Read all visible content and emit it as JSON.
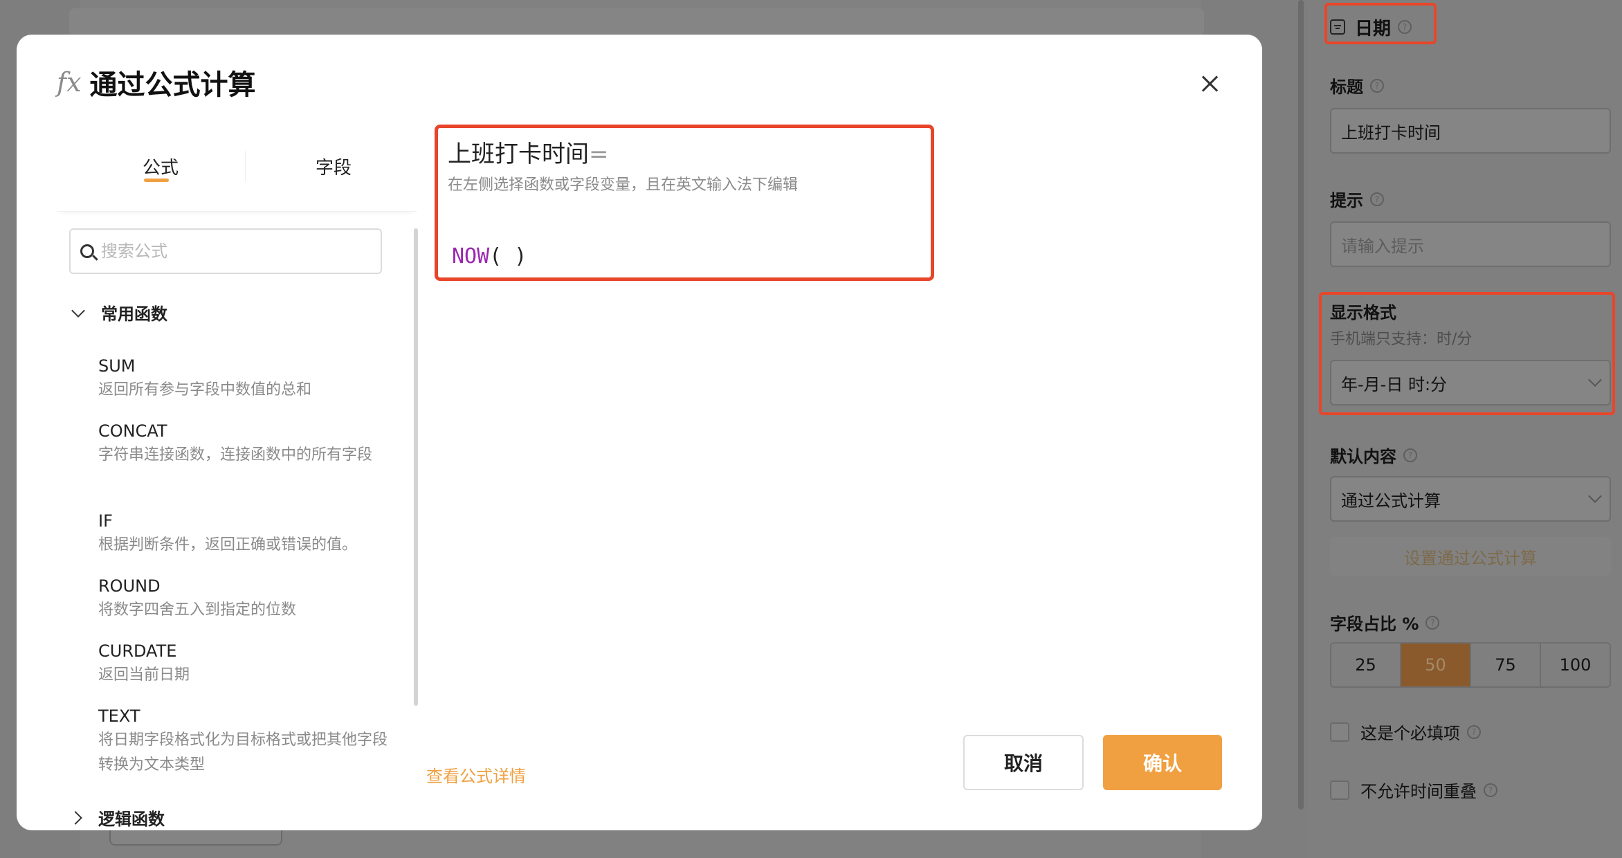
{
  "modal": {
    "title": "通过公式计算",
    "fx_glyph": "fx",
    "tabs": [
      {
        "label": "公式"
      },
      {
        "label": "字段"
      }
    ],
    "search_placeholder": "搜索公式",
    "groups": [
      {
        "label": "常用函数",
        "functions": [
          {
            "name": "SUM",
            "desc": "返回所有参与字段中数值的总和"
          },
          {
            "name": "CONCAT",
            "desc": "字符串连接函数，连接函数中的所有字段"
          },
          {
            "name": "IF",
            "desc": "根据判断条件，返回正确或错误的值。"
          },
          {
            "name": "ROUND",
            "desc": "将数字四舍五入到指定的位数"
          },
          {
            "name": "CURDATE",
            "desc": "返回当前日期"
          },
          {
            "name": "TEXT",
            "desc": "将日期字段格式化为目标格式或把其他字段转换为文本类型"
          }
        ]
      },
      {
        "label": "逻辑函数"
      }
    ],
    "editor": {
      "field_name": "上班打卡时间",
      "equals": "=",
      "hint": "在左侧选择函数或字段变量，且在英文输入法下编辑",
      "code_fn": "NOW",
      "code_parens": "( )"
    },
    "view_details_link": "查看公式详情",
    "cancel_label": "取消",
    "confirm_label": "确认"
  },
  "panel": {
    "title": "日期",
    "title_label": "标题",
    "title_value": "上班打卡时间",
    "prompt_label": "提示",
    "prompt_placeholder": "请输入提示",
    "format_label": "显示格式",
    "format_sub": "手机端只支持：时/分",
    "format_value": "年-月-日 时:分",
    "default_label": "默认内容",
    "default_value": "通过公式计算",
    "set_formula_link": "设置通过公式计算",
    "ratio_label": "字段占比 %",
    "ratio_options": [
      "25",
      "50",
      "75",
      "100"
    ],
    "ratio_selected": "50",
    "required_label": "这是个必填项",
    "no_overlap_label": "不允许时间重叠"
  },
  "colors": {
    "accent": "#f0a040",
    "highlight_border": "#e8452a",
    "function_name": "#9b27b0"
  },
  "icons": {
    "close": "close-icon",
    "search": "search-icon",
    "calendar": "calendar-icon",
    "help": "help-icon"
  }
}
